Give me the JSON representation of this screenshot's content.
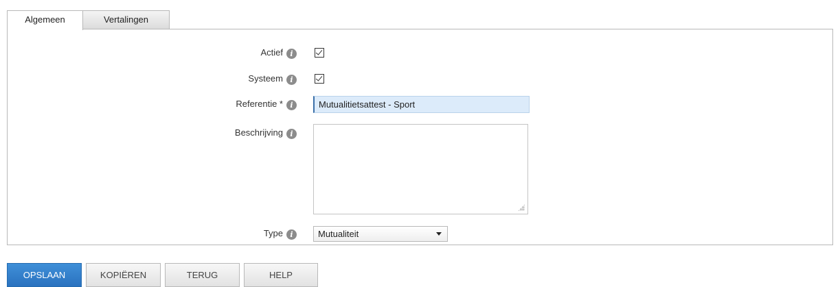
{
  "tabs": [
    {
      "label": "Algemeen",
      "active": true
    },
    {
      "label": "Vertalingen",
      "active": false
    }
  ],
  "form": {
    "actief": {
      "label": "Actief",
      "checked": true
    },
    "systeem": {
      "label": "Systeem",
      "checked": true
    },
    "referentie": {
      "label": "Referentie *",
      "value": "Mutualitietsattest - Sport"
    },
    "beschrijving": {
      "label": "Beschrijving",
      "value": ""
    },
    "type": {
      "label": "Type",
      "selected": "Mutualiteit"
    }
  },
  "icons": {
    "info": "info-icon",
    "info_glyph": "i",
    "checkbox": "check-icon",
    "dropdown": "chevron-down-icon"
  },
  "buttons": {
    "save": "OPSLAAN",
    "copy": "KOPIËREN",
    "back": "TERUG",
    "help": "HELP"
  },
  "colors": {
    "primary_button": "#2f7fcb",
    "input_focus_bg": "#dcebfa",
    "info_icon": "#8c8c8c",
    "border": "#b8b8b8"
  }
}
